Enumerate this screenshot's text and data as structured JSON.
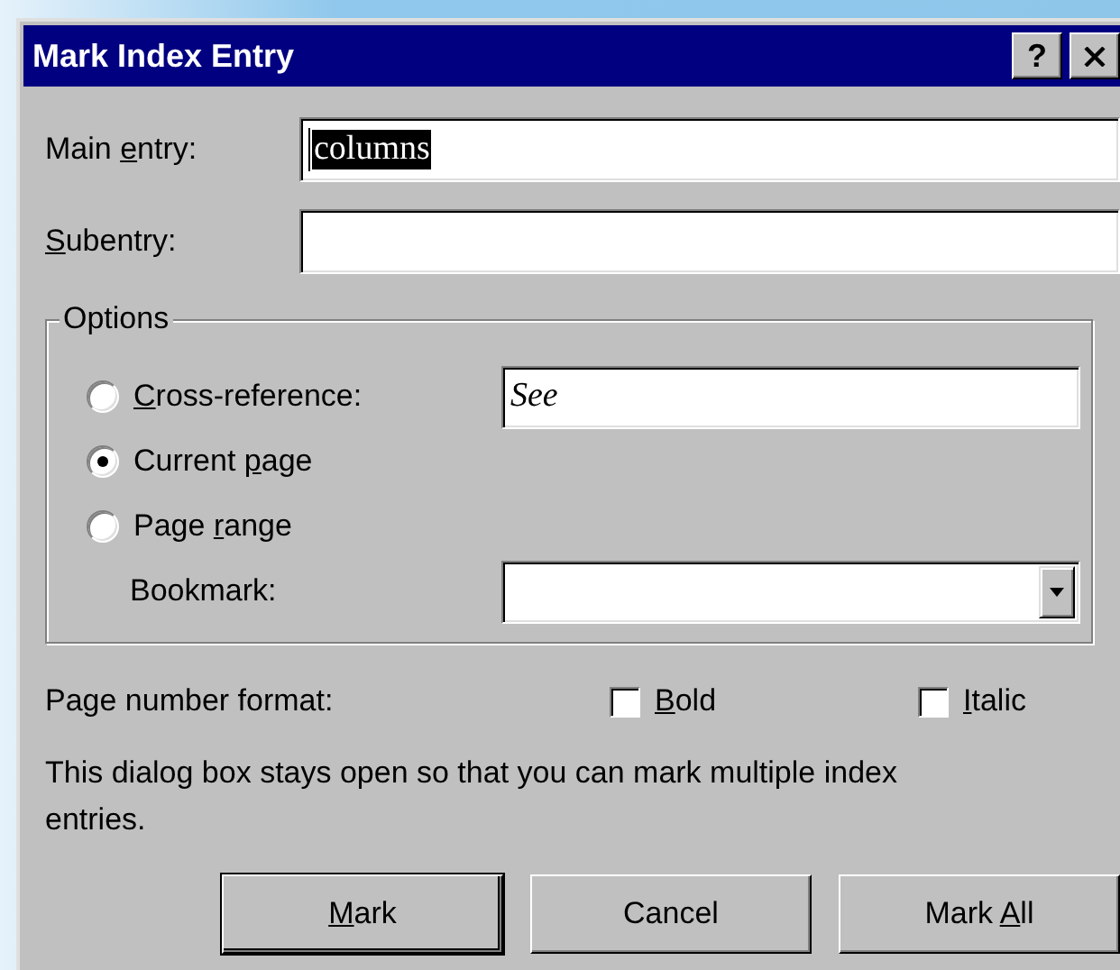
{
  "window": {
    "title": "Mark Index Entry",
    "help_button": "?"
  },
  "main_entry": {
    "label": {
      "pre": "Main ",
      "key": "e",
      "post": "ntry:"
    },
    "value": "columns",
    "value_selected": true
  },
  "subentry": {
    "label": {
      "key": "S",
      "post": "ubentry:"
    }
  },
  "options": {
    "title": "Options",
    "radios": [
      {
        "label": {
          "key": "C",
          "post": "ross-reference:"
        },
        "selected": false,
        "value": "See"
      },
      {
        "label": {
          "pre": "Current ",
          "key": "p",
          "post": "age"
        },
        "selected": true
      },
      {
        "label": {
          "pre": "Page ",
          "key": "r",
          "post": "ange"
        },
        "selected": false
      }
    ],
    "bookmark": {
      "label": {
        "pre": "Bookmark:"
      }
    }
  },
  "page_number_format": {
    "label": {
      "pre": "Page number format:"
    },
    "checkboxes": [
      {
        "label": {
          "key": "B",
          "post": "old"
        },
        "checked": false
      },
      {
        "label": {
          "key": "I",
          "post": "talic"
        },
        "checked": false
      }
    ]
  },
  "note": "This dialog box stays open so that you can mark multiple index entries.",
  "buttons": [
    {
      "label": {
        "key": "M",
        "post": "ark"
      },
      "default": true
    },
    {
      "label": {
        "pre": "Cancel"
      },
      "default": false
    },
    {
      "label": {
        "pre": "Mark ",
        "key": "A",
        "post": "ll"
      },
      "default": false
    }
  ]
}
